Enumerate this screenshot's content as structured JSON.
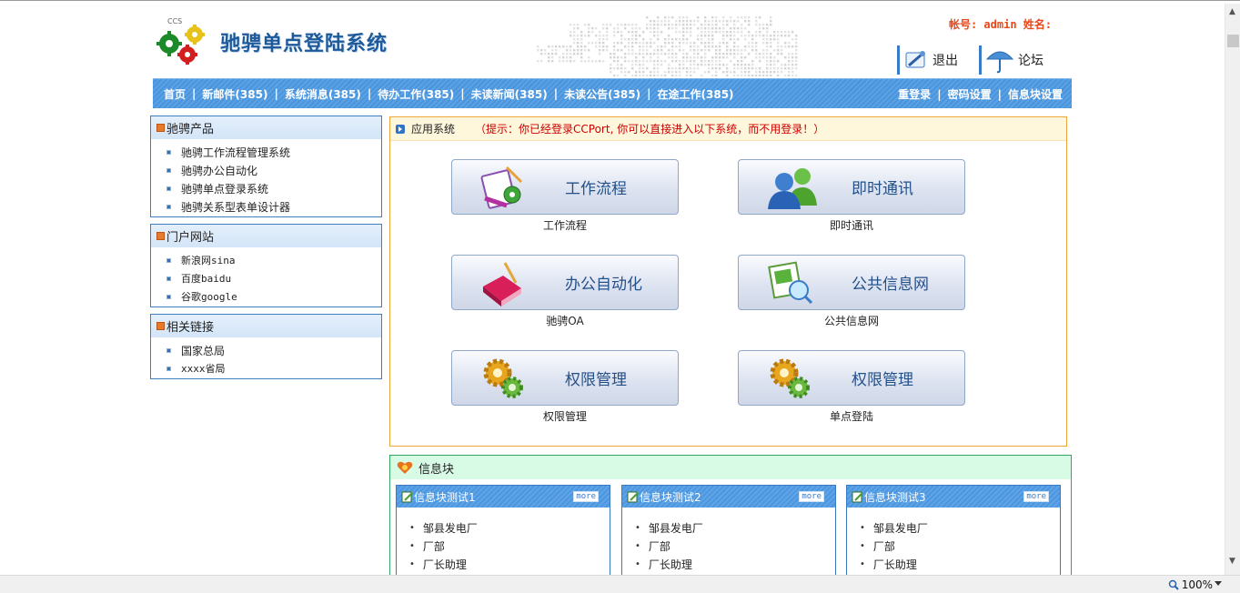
{
  "header": {
    "logo_small_text": "CCS",
    "title": "驰骋单点登陆系统",
    "account_label": "帐号: admin 姓名:",
    "logout_label": "退出",
    "forum_label": "论坛"
  },
  "nav": {
    "left": [
      "首页",
      "新邮件(385)",
      "系统消息(385)",
      "待办工作(385)",
      "未读新闻(385)",
      "未读公告(385)",
      "在途工作(385)"
    ],
    "right": [
      "重登录",
      "密码设置",
      "信息块设置"
    ]
  },
  "sidebar": [
    {
      "title": "驰骋产品",
      "items": [
        "驰骋工作流程管理系统",
        "驰骋办公自动化",
        "驰骋单点登录系统",
        "驰骋关系型表单设计器"
      ]
    },
    {
      "title": "门户网站",
      "items": [
        "新浪网sina",
        "百度baidu",
        "谷歌google"
      ]
    },
    {
      "title": "相关链接",
      "items": [
        "国家总局",
        "xxxx省局"
      ]
    }
  ],
  "apps": {
    "title": "应用系统",
    "tip": "（提示：你已经登录CCPort, 你可以直接进入以下系统，而不用登录！）",
    "tiles": [
      {
        "label": "工作流程",
        "caption": "工作流程",
        "icon": "workflow-icon"
      },
      {
        "label": "即时通讯",
        "caption": "即时通讯",
        "icon": "users-icon"
      },
      {
        "label": "办公自动化",
        "caption": "驰骋OA",
        "icon": "book-icon"
      },
      {
        "label": "公共信息网",
        "caption": "公共信息网",
        "icon": "document-icon"
      },
      {
        "label": "权限管理",
        "caption": "权限管理",
        "icon": "gears-icon"
      },
      {
        "label": "权限管理",
        "caption": "单点登陆",
        "icon": "gears-icon"
      }
    ]
  },
  "info": {
    "title": "信息块",
    "blocks": [
      {
        "title": "信息块测试1",
        "more": "more",
        "items": [
          "邹县发电厂",
          "厂部",
          "厂长助理"
        ]
      },
      {
        "title": "信息块测试2",
        "more": "more",
        "items": [
          "邹县发电厂",
          "厂部",
          "厂长助理"
        ]
      },
      {
        "title": "信息块测试3",
        "more": "more",
        "items": [
          "邹县发电厂",
          "厂部",
          "厂长助理"
        ]
      }
    ]
  },
  "statusbar": {
    "zoom": "100%"
  },
  "colors": {
    "accent": "#4b94dc",
    "alert": "#cc0000",
    "account": "#e8471a",
    "app_border": "#f0a43a",
    "info_border": "#35a860"
  }
}
